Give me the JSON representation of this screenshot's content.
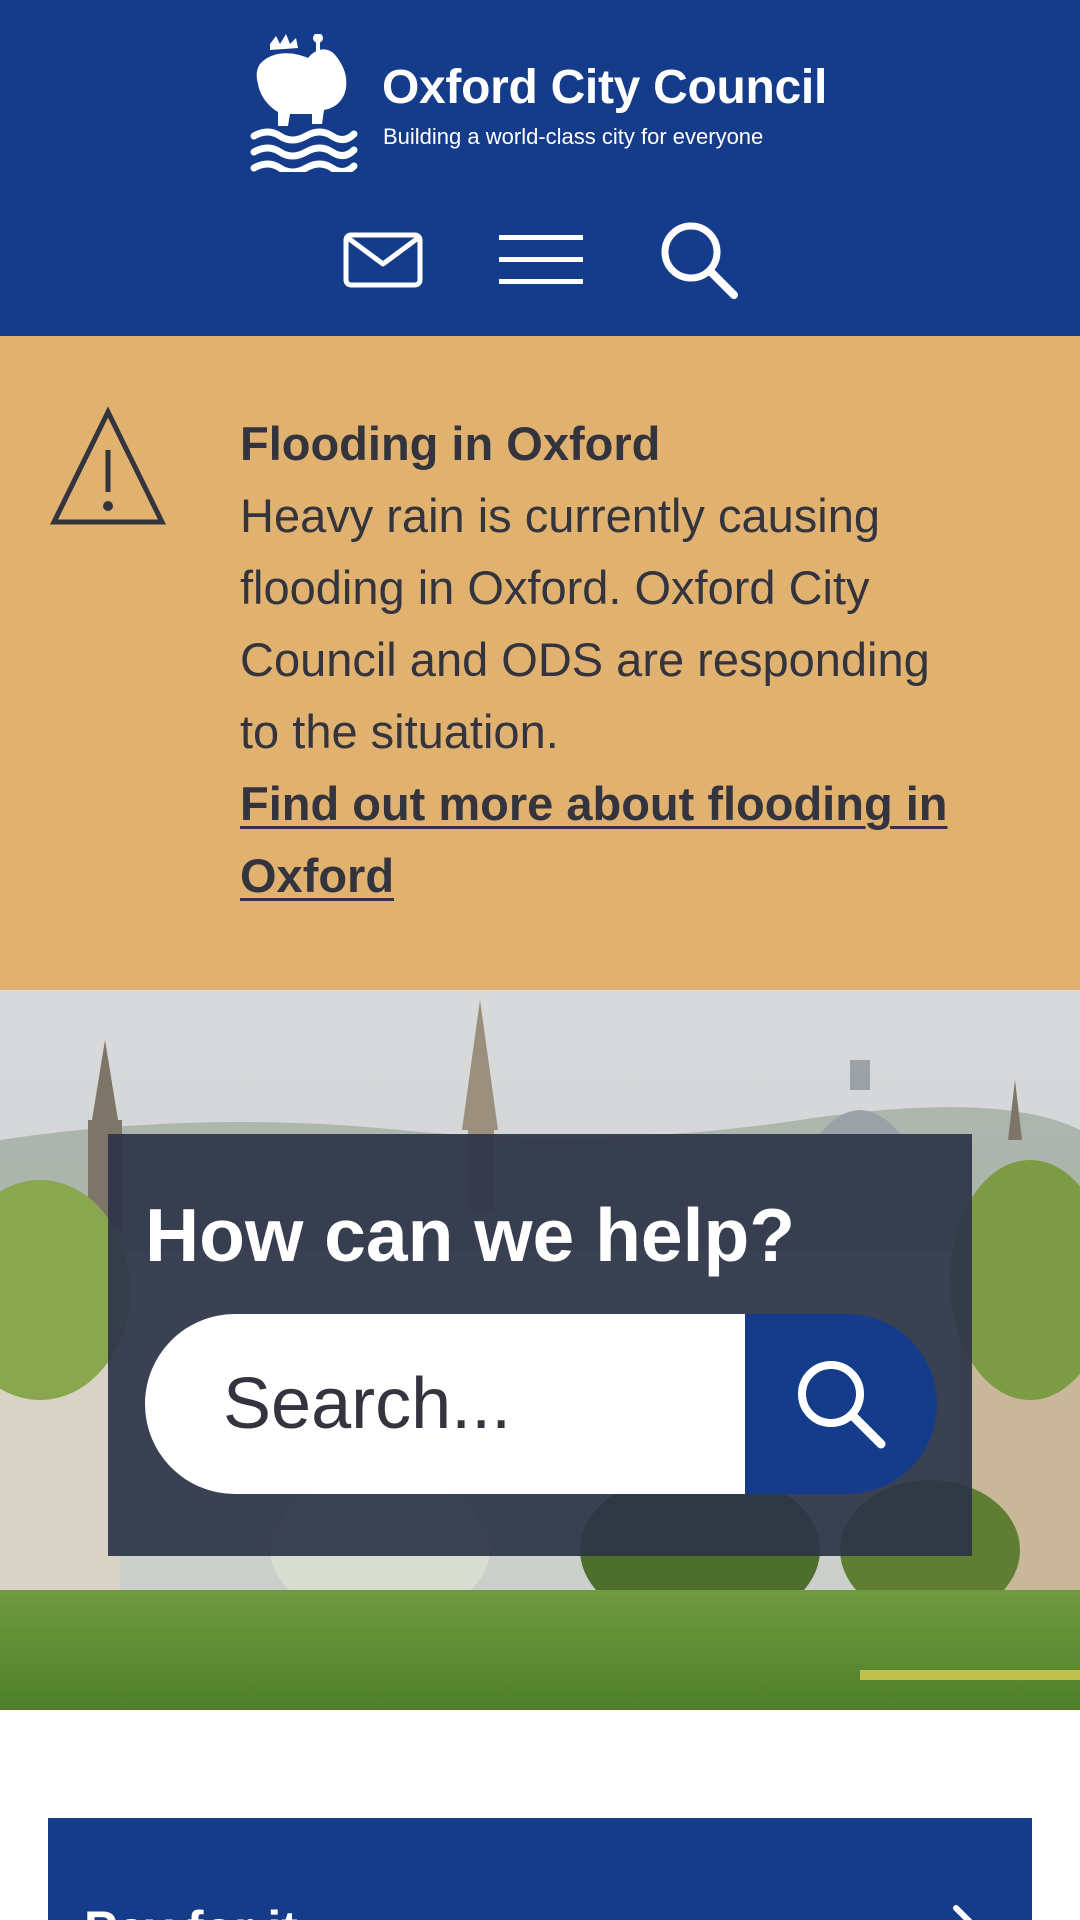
{
  "header": {
    "org_name": "Oxford City Council",
    "tagline": "Building a world-class city for everyone",
    "background": "#153c8a",
    "actions": [
      {
        "icon": "mail-icon"
      },
      {
        "icon": "menu-icon"
      },
      {
        "icon": "search-icon"
      }
    ]
  },
  "alert": {
    "background": "#e1b26f",
    "icon": "warning-icon",
    "title": "Flooding in Oxford",
    "text": "Heavy rain is currently causing flooding in Oxford. Oxford City Council and ODS are responding to the situation.",
    "link_text": "Find out more about flooding in Oxford"
  },
  "hero": {
    "heading": "How can we help?",
    "search_placeholder": "Search...",
    "search_button_icon": "search-icon"
  },
  "cards": [
    {
      "label": "Pay for it",
      "icon": "chevron-right-icon"
    }
  ]
}
